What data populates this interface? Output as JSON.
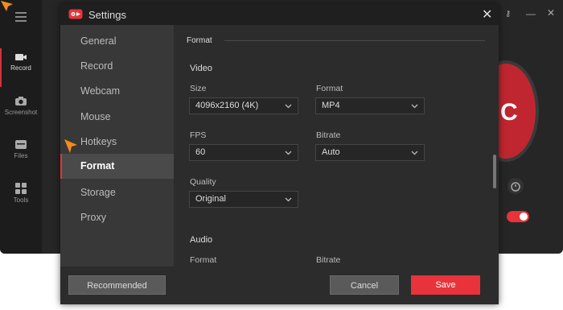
{
  "app": {
    "sidebar": [
      {
        "label": "Record",
        "icon": "camcorder-icon"
      },
      {
        "label": "Screenshot",
        "icon": "camera-icon"
      },
      {
        "label": "Files",
        "icon": "folder-icon"
      },
      {
        "label": "Tools",
        "icon": "tools-grid-icon"
      }
    ],
    "record_letter": "C",
    "accent_color": "#e8333b"
  },
  "dialog": {
    "title": "Settings",
    "nav": [
      "General",
      "Record",
      "Webcam",
      "Mouse",
      "Hotkeys",
      "Format",
      "Storage",
      "Proxy"
    ],
    "active_nav": "Format",
    "section_title": "Format",
    "video": {
      "heading": "Video",
      "size_label": "Size",
      "size_value": "4096x2160 (4K)",
      "format_label": "Format",
      "format_value": "MP4",
      "fps_label": "FPS",
      "fps_value": "60",
      "bitrate_label": "Bitrate",
      "bitrate_value": "Auto",
      "quality_label": "Quality",
      "quality_value": "Original"
    },
    "audio": {
      "heading": "Audio",
      "format_label": "Format",
      "bitrate_label": "Bitrate"
    },
    "buttons": {
      "recommended": "Recommended",
      "cancel": "Cancel",
      "save": "Save"
    }
  }
}
